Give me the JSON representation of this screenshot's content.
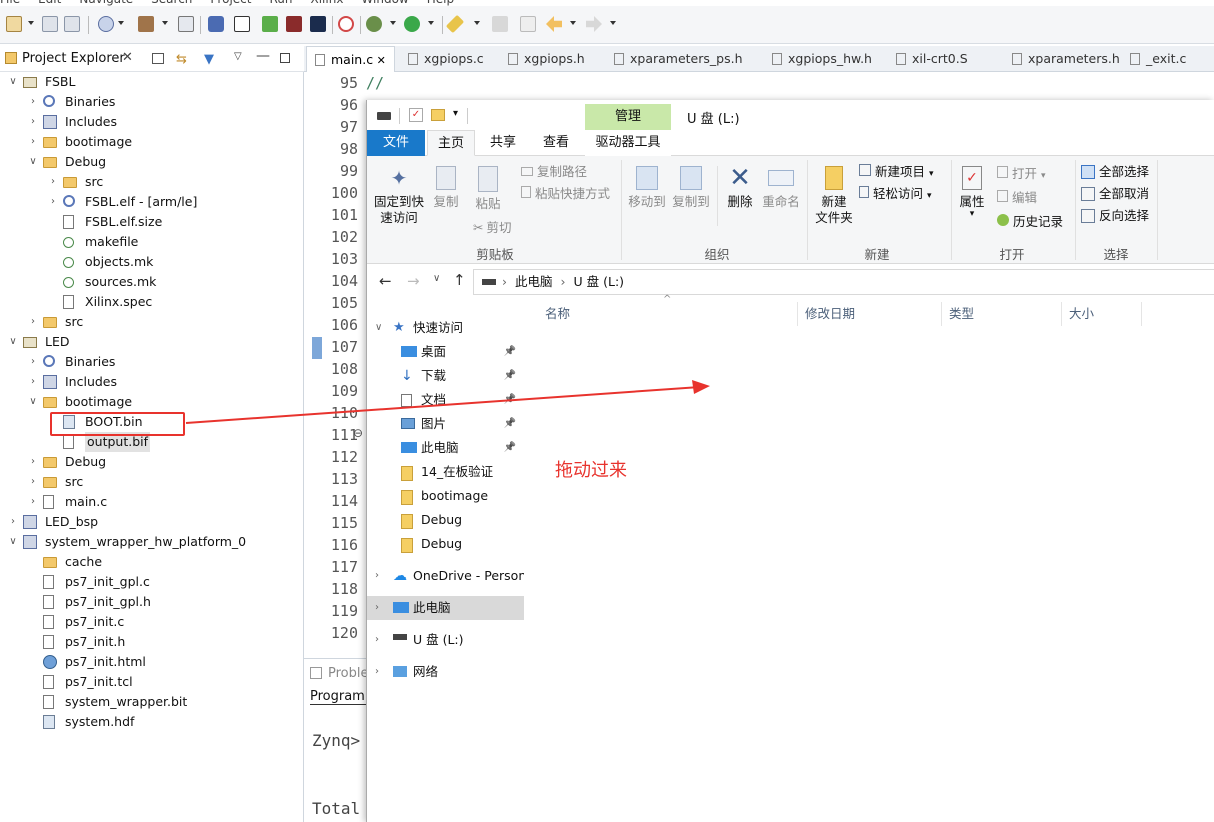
{
  "menubar": [
    "File",
    "Edit",
    "Navigate",
    "Search",
    "Project",
    "Run",
    "Xilinx",
    "Window",
    "Help"
  ],
  "project_explorer": {
    "title": "Project Explorer",
    "items": [
      {
        "label": "FSBL",
        "depth": 0,
        "icon": "project",
        "twisty": "open"
      },
      {
        "label": "Binaries",
        "depth": 1,
        "icon": "binaries",
        "twisty": "closed"
      },
      {
        "label": "Includes",
        "depth": 1,
        "icon": "includes",
        "twisty": "closed"
      },
      {
        "label": "bootimage",
        "depth": 1,
        "icon": "folder",
        "twisty": "closed"
      },
      {
        "label": "Debug",
        "depth": 1,
        "icon": "folder",
        "twisty": "open"
      },
      {
        "label": "src",
        "depth": 2,
        "icon": "folder",
        "twisty": "closed"
      },
      {
        "label": "FSBL.elf - [arm/le]",
        "depth": 2,
        "icon": "elf",
        "twisty": "closed"
      },
      {
        "label": "FSBL.elf.size",
        "depth": 2,
        "icon": "file",
        "twisty": "none"
      },
      {
        "label": "makefile",
        "depth": 2,
        "icon": "make",
        "twisty": "none"
      },
      {
        "label": "objects.mk",
        "depth": 2,
        "icon": "make",
        "twisty": "none"
      },
      {
        "label": "sources.mk",
        "depth": 2,
        "icon": "make",
        "twisty": "none"
      },
      {
        "label": "Xilinx.spec",
        "depth": 2,
        "icon": "file",
        "twisty": "none"
      },
      {
        "label": "src",
        "depth": 1,
        "icon": "folder",
        "twisty": "closed"
      },
      {
        "label": "LED",
        "depth": 0,
        "icon": "project",
        "twisty": "open"
      },
      {
        "label": "Binaries",
        "depth": 1,
        "icon": "binaries",
        "twisty": "closed"
      },
      {
        "label": "Includes",
        "depth": 1,
        "icon": "includes",
        "twisty": "closed"
      },
      {
        "label": "bootimage",
        "depth": 1,
        "icon": "folder",
        "twisty": "open"
      },
      {
        "label": "BOOT.bin",
        "depth": 2,
        "icon": "bin",
        "twisty": "none"
      },
      {
        "label": "output.bif",
        "depth": 2,
        "icon": "file",
        "twisty": "none"
      },
      {
        "label": "Debug",
        "depth": 1,
        "icon": "folder",
        "twisty": "closed"
      },
      {
        "label": "src",
        "depth": 1,
        "icon": "folder",
        "twisty": "closed"
      },
      {
        "label": "main.c",
        "depth": 1,
        "icon": "cfile",
        "twisty": "closed"
      },
      {
        "label": "LED_bsp",
        "depth": 0,
        "icon": "lib",
        "twisty": "closed"
      },
      {
        "label": "system_wrapper_hw_platform_0",
        "depth": 0,
        "icon": "lib",
        "twisty": "open"
      },
      {
        "label": "cache",
        "depth": 1,
        "icon": "folder",
        "twisty": "none"
      },
      {
        "label": "ps7_init_gpl.c",
        "depth": 1,
        "icon": "cfile",
        "twisty": "none"
      },
      {
        "label": "ps7_init_gpl.h",
        "depth": 1,
        "icon": "hfile",
        "twisty": "none"
      },
      {
        "label": "ps7_init.c",
        "depth": 1,
        "icon": "cfile",
        "twisty": "none"
      },
      {
        "label": "ps7_init.h",
        "depth": 1,
        "icon": "hfile",
        "twisty": "none"
      },
      {
        "label": "ps7_init.html",
        "depth": 1,
        "icon": "globe",
        "twisty": "none"
      },
      {
        "label": "ps7_init.tcl",
        "depth": 1,
        "icon": "file",
        "twisty": "none"
      },
      {
        "label": "system_wrapper.bit",
        "depth": 1,
        "icon": "file",
        "twisty": "none"
      },
      {
        "label": "system.hdf",
        "depth": 1,
        "icon": "hdf",
        "twisty": "none"
      }
    ]
  },
  "editor": {
    "tabs": [
      "main.c",
      "xgpiops.c",
      "xgpiops.h",
      "xparameters_ps.h",
      "xgpiops_hw.h",
      "xil-crt0.S",
      "xparameters.h",
      "_exit.c"
    ],
    "line_numbers": [
      "95",
      "96",
      "97",
      "98",
      "99",
      "100",
      "101",
      "102",
      "103",
      "104",
      "105",
      "106",
      "107",
      "108",
      "109",
      "110",
      "111",
      "112",
      "113",
      "114",
      "115",
      "116",
      "117",
      "118",
      "119",
      "120"
    ],
    "first_line_code": "//",
    "console": {
      "tab": "Proble",
      "subtab": "Program",
      "line1": "Zynq>",
      "line2": "Total"
    }
  },
  "explorer_window": {
    "manage_tab": "管理",
    "title": "U 盘 (L:)",
    "ribbon_tabs": [
      "文件",
      "主页",
      "共享",
      "查看",
      "驱动器工具"
    ],
    "clipboard": {
      "pin": "固定到快\n速访问",
      "copy": "复制",
      "paste": "粘贴",
      "copy_path": "复制路径",
      "paste_shortcut": "粘贴快捷方式",
      "cut": "剪切",
      "group": "剪贴板"
    },
    "organize": {
      "move_to": "移动到",
      "copy_to": "复制到",
      "delete": "删除",
      "rename": "重命名",
      "group": "组织"
    },
    "new": {
      "new_folder": "新建\n文件夹",
      "new_item": "新建项目",
      "easy_access": "轻松访问",
      "group": "新建"
    },
    "open": {
      "properties": "属性",
      "open": "打开",
      "edit": "编辑",
      "history": "历史记录",
      "group": "打开"
    },
    "select": {
      "select_all": "全部选择",
      "select_none": "全部取消",
      "invert": "反向选择",
      "group": "选择"
    },
    "address": {
      "this_pc": "此电脑",
      "drive": "U 盘 (L:)"
    },
    "columns": [
      "名称",
      "修改日期",
      "类型",
      "大小"
    ],
    "nav": [
      {
        "label": "快速访问",
        "type": "header",
        "icon": "star-icon"
      },
      {
        "label": "桌面",
        "type": "item",
        "icon": "desktop-icon",
        "pinned": true
      },
      {
        "label": "下载",
        "type": "item",
        "icon": "download-icon",
        "pinned": true
      },
      {
        "label": "文档",
        "type": "item",
        "icon": "document-icon",
        "pinned": true
      },
      {
        "label": "图片",
        "type": "item",
        "icon": "picture-icon",
        "pinned": true
      },
      {
        "label": "此电脑",
        "type": "item",
        "icon": "pc-icon",
        "pinned": true
      },
      {
        "label": "14_在板验证",
        "type": "item",
        "icon": "folder-icon",
        "pinned": false
      },
      {
        "label": "bootimage",
        "type": "item",
        "icon": "folder-icon",
        "pinned": false
      },
      {
        "label": "Debug",
        "type": "item",
        "icon": "folder-icon",
        "pinned": false
      },
      {
        "label": "Debug",
        "type": "item",
        "icon": "folder-icon",
        "pinned": false
      },
      {
        "label": "OneDrive - Persona",
        "type": "header",
        "icon": "cloud-icon"
      },
      {
        "label": "此电脑",
        "type": "header",
        "icon": "pc-icon",
        "selected": true
      },
      {
        "label": "U 盘 (L:)",
        "type": "header",
        "icon": "drive-icon"
      },
      {
        "label": "网络",
        "type": "header",
        "icon": "network-icon"
      }
    ]
  },
  "annotation": {
    "text": "拖动过来",
    "color": "#e8332d"
  }
}
